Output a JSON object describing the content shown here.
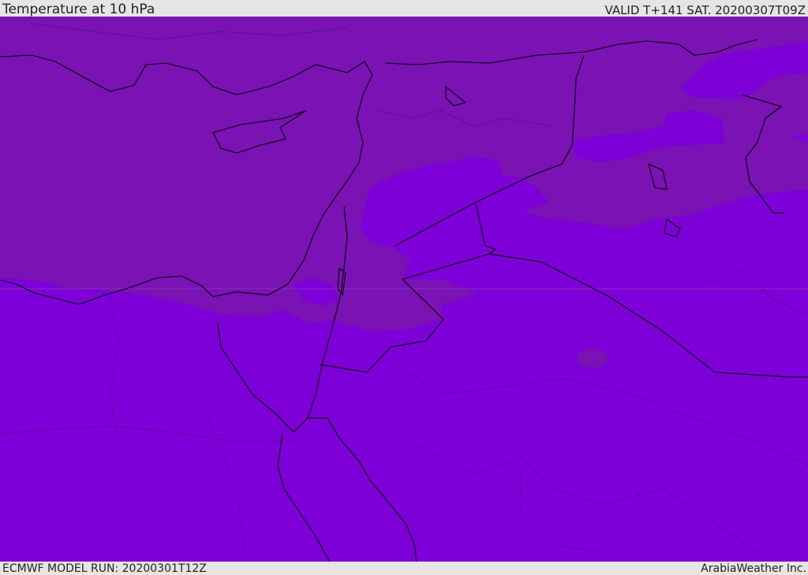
{
  "header": {
    "title": "Temperature at 10 hPa",
    "valid_time": "VALID T+141 SAT. 20200307T09Z"
  },
  "footer": {
    "model_run": "ECMWF MODEL RUN: 20200301T12Z",
    "credit": "ArabiaWeather Inc."
  },
  "map": {
    "colors": {
      "warmer_band": "#7a12b4",
      "colder_band": "#7d00d8",
      "coastline": "#000000"
    }
  }
}
